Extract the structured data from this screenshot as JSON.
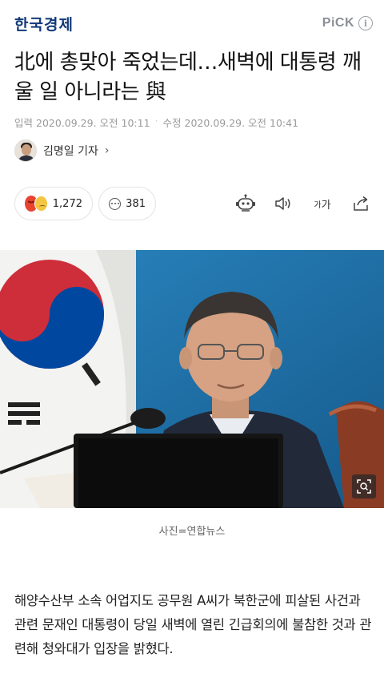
{
  "header": {
    "logo": "한국경제",
    "pick_label": "PiCK",
    "info_icon": "info-icon"
  },
  "article": {
    "title": "北에 총맞아 죽었는데…새벽에 대통령 깨울 일 아니라는 與",
    "published_label": "입력",
    "published": "2020.09.29. 오전 10:11",
    "modified_label": "수정",
    "modified": "2020.09.29. 오전 10:41",
    "reporter": "김명일 기자",
    "reporter_chevron": "›"
  },
  "actions": {
    "reaction_count": "1,272",
    "comment_count": "381",
    "font_label_small": "가",
    "font_label_large": "가",
    "icons": [
      "angry-emoji-icon",
      "sad-emoji-icon",
      "speech-bubble-icon",
      "robot-summary-icon",
      "speaker-icon",
      "font-size-icon",
      "share-icon"
    ]
  },
  "photo": {
    "caption": "사진=연합뉴스",
    "zoom_icon": "zoom-icon"
  },
  "body": {
    "paragraph": "해양수산부 소속 어업지도 공무원 A씨가 북한군에 피살된 사건과 관련 문재인 대통령이 당일 새벽에 열린 긴급회의에 불참한 것과 관련해 청와대가 입장을 밝혔다."
  },
  "colors": {
    "logo": "#123a7a",
    "pick": "#8a8f96",
    "meta": "#9a9a9a"
  }
}
